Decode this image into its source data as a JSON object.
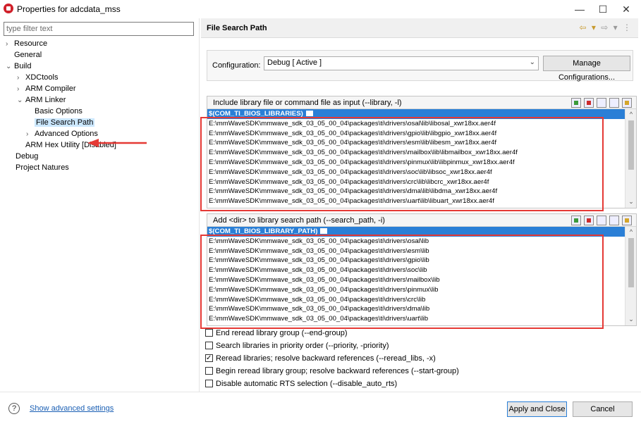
{
  "window": {
    "title": "Properties for adcdata_mss",
    "minimize": "—",
    "maximize": "☐",
    "close": "✕"
  },
  "filter": {
    "placeholder": "type filter text"
  },
  "tree": [
    {
      "label": "Resource",
      "arrow": "›"
    },
    {
      "label": "General",
      "arrow": ""
    },
    {
      "label": "Build",
      "arrow": "⌄"
    },
    {
      "label": "XDCtools",
      "arrow": "›"
    },
    {
      "label": "ARM Compiler",
      "arrow": "›"
    },
    {
      "label": "ARM Linker",
      "arrow": "⌄"
    },
    {
      "label": "Basic Options",
      "arrow": ""
    },
    {
      "label": "File Search Path",
      "arrow": ""
    },
    {
      "label": "Advanced Options",
      "arrow": "›"
    },
    {
      "label": "ARM Hex Utility  [Disabled]",
      "arrow": ""
    },
    {
      "label": "Debug",
      "arrow": ""
    },
    {
      "label": "Project Natures",
      "arrow": ""
    }
  ],
  "page": {
    "title": "File Search Path",
    "nav": {
      "back": "⇦ ▾",
      "forward": "⇨ ▾",
      "menu": "⋮"
    }
  },
  "config": {
    "label": "Configuration:",
    "value": "Debug  [ Active ]",
    "manage_button": "Manage Configurations..."
  },
  "libraries": {
    "header": "Include library file or command file as input (--library, -l)",
    "items": [
      "$(COM_TI_BIOS_LIBRARIES)",
      "E:\\mmWaveSDK\\mmwave_sdk_03_05_00_04\\packages\\ti\\drivers\\osal\\lib\\libosal_xwr18xx.aer4f",
      "E:\\mmWaveSDK\\mmwave_sdk_03_05_00_04\\packages\\ti\\drivers\\gpio\\lib\\libgpio_xwr18xx.aer4f",
      "E:\\mmWaveSDK\\mmwave_sdk_03_05_00_04\\packages\\ti\\drivers\\esm\\lib\\libesm_xwr18xx.aer4f",
      "E:\\mmWaveSDK\\mmwave_sdk_03_05_00_04\\packages\\ti\\drivers\\mailbox\\lib\\libmailbox_xwr18xx.aer4f",
      "E:\\mmWaveSDK\\mmwave_sdk_03_05_00_04\\packages\\ti\\drivers\\pinmux\\lib\\libpinmux_xwr18xx.aer4f",
      "E:\\mmWaveSDK\\mmwave_sdk_03_05_00_04\\packages\\ti\\drivers\\soc\\lib\\libsoc_xwr18xx.aer4f",
      "E:\\mmWaveSDK\\mmwave_sdk_03_05_00_04\\packages\\ti\\drivers\\crc\\lib\\libcrc_xwr18xx.aer4f",
      "E:\\mmWaveSDK\\mmwave_sdk_03_05_00_04\\packages\\ti\\drivers\\dma\\lib\\libdma_xwr18xx.aer4f",
      "E:\\mmWaveSDK\\mmwave_sdk_03_05_00_04\\packages\\ti\\drivers\\uart\\lib\\libuart_xwr18xx.aer4f"
    ]
  },
  "search_paths": {
    "header": "Add <dir> to library search path (--search_path, -i)",
    "items": [
      "$(COM_TI_BIOS_LIBRARY_PATH)",
      "E:\\mmWaveSDK\\mmwave_sdk_03_05_00_04\\packages\\ti\\drivers\\osal\\lib",
      "E:\\mmWaveSDK\\mmwave_sdk_03_05_00_04\\packages\\ti\\drivers\\esm\\lib",
      "E:\\mmWaveSDK\\mmwave_sdk_03_05_00_04\\packages\\ti\\drivers\\gpio\\lib",
      "E:\\mmWaveSDK\\mmwave_sdk_03_05_00_04\\packages\\ti\\drivers\\soc\\lib",
      "E:\\mmWaveSDK\\mmwave_sdk_03_05_00_04\\packages\\ti\\drivers\\mailbox\\lib",
      "E:\\mmWaveSDK\\mmwave_sdk_03_05_00_04\\packages\\ti\\drivers\\pinmux\\lib",
      "E:\\mmWaveSDK\\mmwave_sdk_03_05_00_04\\packages\\ti\\drivers\\crc\\lib",
      "E:\\mmWaveSDK\\mmwave_sdk_03_05_00_04\\packages\\ti\\drivers\\dma\\lib",
      "E:\\mmWaveSDK\\mmwave_sdk_03_05_00_04\\packages\\ti\\drivers\\uart\\lib"
    ]
  },
  "options": [
    {
      "label": "End reread library group (--end-group)",
      "checked": false
    },
    {
      "label": "Search libraries in priority order (--priority, -priority)",
      "checked": false
    },
    {
      "label": "Reread libraries; resolve backward references (--reread_libs, -x)",
      "checked": true
    },
    {
      "label": "Begin reread library group; resolve backward references (--start-group)",
      "checked": false
    },
    {
      "label": "Disable automatic RTS selection (--disable_auto_rts)",
      "checked": false
    }
  ],
  "footer": {
    "help_icon": "?",
    "advanced_link": "Show advanced settings",
    "apply_button": "Apply and Close",
    "cancel_button": "Cancel"
  },
  "colors": {
    "selection": "#2a7fd6",
    "annotation_red": "#e53935",
    "link": "#1a5fb4"
  }
}
